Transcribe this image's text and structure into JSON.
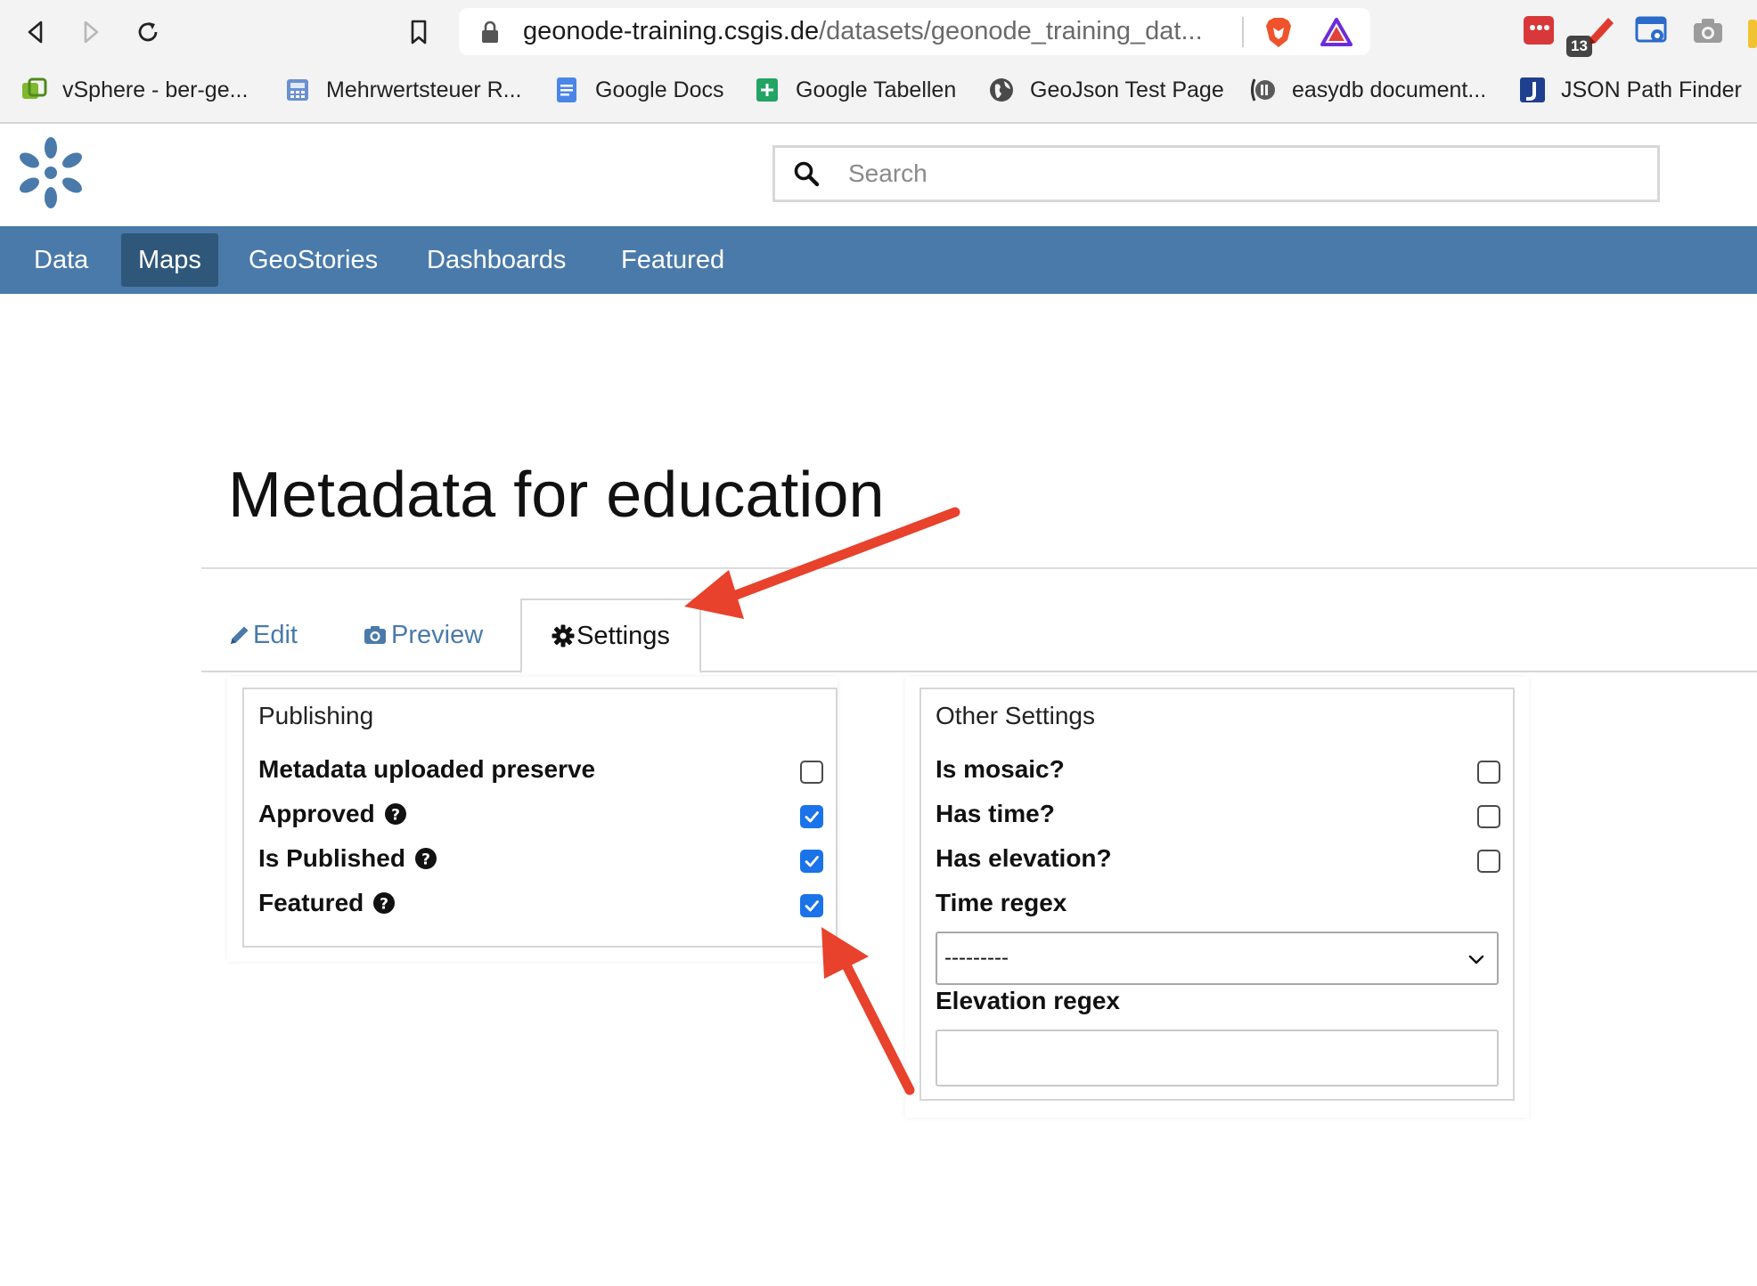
{
  "browser": {
    "url_host": "geonode-training.csgis.de",
    "url_path": "/datasets/geonode_training_dat...",
    "extension_badge": "13",
    "bookmarks": [
      {
        "label": "vSphere - ber-ge...",
        "icon": "vsphere-icon"
      },
      {
        "label": "Mehrwertsteuer R...",
        "icon": "calculator-icon"
      },
      {
        "label": "Google Docs",
        "icon": "google-docs-icon"
      },
      {
        "label": "Google Tabellen",
        "icon": "google-sheets-icon"
      },
      {
        "label": "GeoJson Test Page",
        "icon": "globe-icon"
      },
      {
        "label": "easydb document...",
        "icon": "easydb-icon"
      },
      {
        "label": "JSON Path Finder",
        "icon": "json-path-icon"
      }
    ]
  },
  "header": {
    "search_placeholder": "Search"
  },
  "nav": {
    "items": [
      {
        "label": "Data",
        "active": false
      },
      {
        "label": "Maps",
        "active": true
      },
      {
        "label": "GeoStories",
        "active": false
      },
      {
        "label": "Dashboards",
        "active": false
      },
      {
        "label": "Featured",
        "active": false
      }
    ]
  },
  "page": {
    "title": "Metadata for education",
    "tabs": [
      {
        "label": "Edit",
        "icon": "pencil-icon",
        "active": false
      },
      {
        "label": "Preview",
        "icon": "camera-icon",
        "active": false
      },
      {
        "label": "Settings",
        "icon": "gear-icon",
        "active": true
      }
    ]
  },
  "publishing": {
    "title": "Publishing",
    "fields": [
      {
        "label": "Metadata uploaded preserve",
        "checked": false,
        "help": false
      },
      {
        "label": "Approved",
        "checked": true,
        "help": true
      },
      {
        "label": "Is Published",
        "checked": true,
        "help": true
      },
      {
        "label": "Featured",
        "checked": true,
        "help": true
      }
    ]
  },
  "other_settings": {
    "title": "Other Settings",
    "fields": [
      {
        "label": "Is mosaic?",
        "checked": false
      },
      {
        "label": "Has time?",
        "checked": false
      },
      {
        "label": "Has elevation?",
        "checked": false
      }
    ],
    "time_regex_label": "Time regex",
    "time_regex_value": "---------",
    "elevation_regex_label": "Elevation regex",
    "elevation_regex_value": ""
  },
  "colors": {
    "nav_bg": "#4a7aaa",
    "nav_active": "#2f5779",
    "checkbox_checked": "#1a73e8",
    "annotation_arrow": "#e8412c"
  }
}
